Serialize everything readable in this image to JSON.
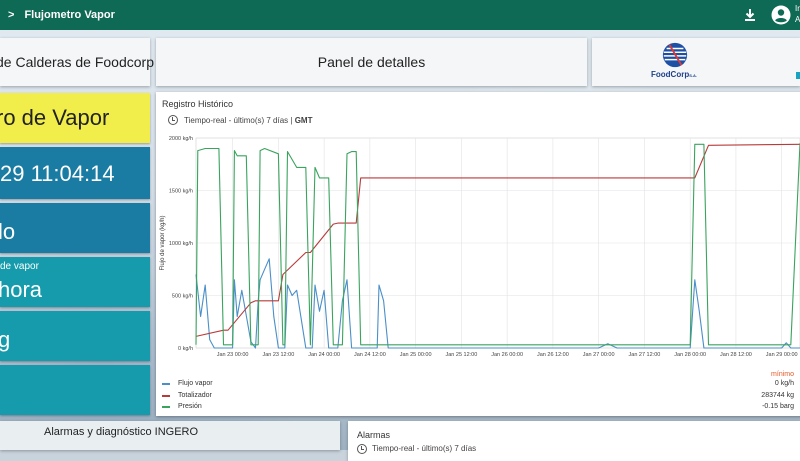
{
  "topbar": {
    "chevron": ">",
    "title": "Flujometro Vapor",
    "user_line1": "In",
    "user_line2": "A"
  },
  "header": {
    "left_title": "de Calderas de Foodcorp",
    "center_title": "Panel de detalles",
    "logo_text": "FoodCorp",
    "logo_suffix": "S.A."
  },
  "tiles": {
    "title_fragment": "ro de Vapor",
    "datetime": "29 11:04:14",
    "status": "lo",
    "flow_label": "de vapor",
    "flow_value": "hora",
    "unit_fragment": "g"
  },
  "chart_panel": {
    "title": "Registro Histórico",
    "subtitle_prefix": "Tiempo-real - último(s) 7 días | ",
    "subtitle_tz": "GMT"
  },
  "chart_data": {
    "type": "line",
    "title": "Registro Histórico",
    "ylabel": "Flujo de vapor (kg/h)",
    "ylim": [
      0,
      2000
    ],
    "yticks": [
      "0 kg/h",
      "500 kg/h",
      "1000 kg/h",
      "1500 kg/h",
      "2000 kg/h"
    ],
    "xticks": [
      "Jan 23 00:00",
      "Jan 23 12:00",
      "Jan 24 00:00",
      "Jan 24 12:00",
      "Jan 25 00:00",
      "Jan 25 12:00",
      "Jan 26 00:00",
      "Jan 26 12:00",
      "Jan 27 00:00",
      "Jan 27 12:00",
      "Jan 28 00:00",
      "Jan 28 12:00",
      "Jan 29 00:00"
    ],
    "legend_header": "mínimo",
    "series": [
      {
        "name": "Flujo vapor",
        "color": "#4a8fc8",
        "legend_value": "0 kg/h",
        "x": [
          22.6,
          22.65,
          22.7,
          22.75,
          22.8,
          22.82,
          22.85,
          22.9,
          22.95,
          23.0,
          23.02,
          23.05,
          23.1,
          23.2,
          23.25,
          23.28,
          23.3,
          23.35,
          23.4,
          23.45,
          23.5,
          23.55,
          23.57,
          23.6,
          23.65,
          23.7,
          23.8,
          23.82,
          23.85,
          23.87,
          23.9,
          23.95,
          24.0,
          24.05,
          24.1,
          24.15,
          24.2,
          24.25,
          24.3,
          24.4,
          24.45,
          24.5,
          24.55,
          24.58,
          24.6,
          24.65,
          24.7,
          24.75,
          24.8,
          24.9,
          25.0,
          25.5,
          26.0,
          26.5,
          27.0,
          27.1,
          27.2,
          27.5,
          28.0,
          28.05,
          28.1,
          28.15,
          28.2,
          28.5,
          29.0,
          29.05,
          29.1,
          29.2
        ],
        "y": [
          700,
          300,
          600,
          80,
          0,
          0,
          0,
          0,
          0,
          0,
          650,
          300,
          550,
          60,
          0,
          450,
          650,
          750,
          850,
          300,
          0,
          0,
          0,
          600,
          500,
          550,
          0,
          0,
          0,
          0,
          600,
          350,
          550,
          0,
          0,
          0,
          450,
          650,
          0,
          0,
          0,
          0,
          0,
          0,
          600,
          450,
          0,
          0,
          0,
          0,
          0,
          0,
          0,
          0,
          0,
          40,
          0,
          0,
          0,
          650,
          350,
          0,
          0,
          0,
          0,
          50,
          0,
          0
        ]
      },
      {
        "name": "Totalizador",
        "color": "#b83b3b",
        "legend_value": "283744 kg",
        "x": [
          22.6,
          22.9,
          22.95,
          23.2,
          23.25,
          23.5,
          23.55,
          23.8,
          23.85,
          24.1,
          24.15,
          24.35,
          24.4,
          28.0,
          28.05,
          28.2,
          29.2
        ],
        "y": [
          110,
          170,
          170,
          430,
          450,
          450,
          700,
          910,
          910,
          1180,
          1190,
          1190,
          1620,
          1620,
          1620,
          1930,
          1940
        ]
      },
      {
        "name": "Presión",
        "color": "#3aa35e",
        "legend_value": "-0.15 barg",
        "x": [
          22.6,
          22.62,
          22.7,
          22.85,
          22.9,
          23.0,
          23.02,
          23.05,
          23.15,
          23.2,
          23.28,
          23.3,
          23.35,
          23.5,
          23.55,
          23.57,
          23.6,
          23.7,
          23.8,
          23.85,
          23.9,
          23.95,
          24.05,
          24.1,
          24.2,
          24.25,
          24.3,
          24.35,
          24.4,
          28.0,
          28.05,
          28.1,
          28.15,
          28.2,
          29.1,
          29.2
        ],
        "y": [
          30,
          1880,
          1900,
          1900,
          30,
          30,
          1880,
          1830,
          1830,
          30,
          30,
          1880,
          1900,
          1850,
          30,
          30,
          1870,
          1720,
          1720,
          30,
          1720,
          1620,
          1620,
          30,
          30,
          1850,
          1870,
          1870,
          30,
          30,
          1940,
          1940,
          1940,
          30,
          30,
          1950
        ]
      }
    ]
  },
  "legend_values": {
    "flow": "0 kg/h",
    "total": "283744 kg",
    "pressure": "-0.15 barg"
  },
  "bottom": {
    "alarm_diag": "Alarmas y diagnóstico INGERO",
    "alarms_title": "Alarmas",
    "alarms_sub": "Tiempo-real - último(s) 7 días"
  },
  "colors": {
    "topbar": "#0f6a55",
    "yellow_tile": "#f1ee4c",
    "blue_tile": "#1a7ca2",
    "teal_tile": "#159bab"
  }
}
